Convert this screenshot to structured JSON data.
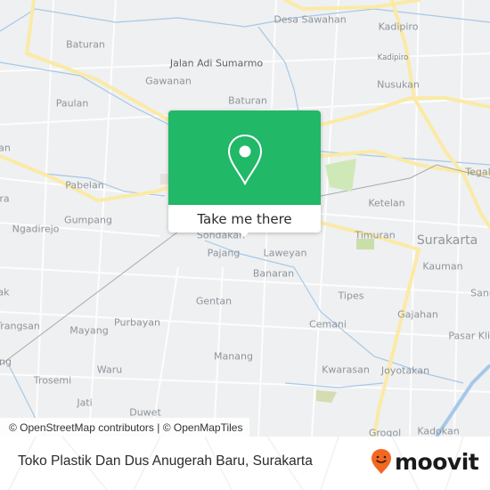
{
  "map": {
    "labels": [
      {
        "text": "Desa Sawahan",
        "kind": "normal"
      },
      {
        "text": "Kadipiro",
        "kind": "normal"
      },
      {
        "text": "Kadipiro",
        "kind": "small"
      },
      {
        "text": "Baturan",
        "kind": "normal"
      },
      {
        "text": "Jalan Adi Sumarmo",
        "kind": "road"
      },
      {
        "text": "Gawanan",
        "kind": "normal"
      },
      {
        "text": "Nusukan",
        "kind": "normal"
      },
      {
        "text": "Baturan",
        "kind": "normal"
      },
      {
        "text": "Paulan",
        "kind": "normal"
      },
      {
        "text": "Pabelan",
        "kind": "normal"
      },
      {
        "text": "Tegalh",
        "kind": "normal"
      },
      {
        "text": "Ketelan",
        "kind": "normal"
      },
      {
        "text": "Gumpang",
        "kind": "normal"
      },
      {
        "text": "Ngadirejo",
        "kind": "normal"
      },
      {
        "text": "Sondakan",
        "kind": "normal"
      },
      {
        "text": "Pajang",
        "kind": "normal"
      },
      {
        "text": "Laweyan",
        "kind": "normal"
      },
      {
        "text": "Timuran",
        "kind": "normal"
      },
      {
        "text": "Surakarta",
        "kind": "city"
      },
      {
        "text": "Kauman",
        "kind": "normal"
      },
      {
        "text": "Banaran",
        "kind": "normal"
      },
      {
        "text": "Tipes",
        "kind": "normal"
      },
      {
        "text": "Sang",
        "kind": "normal"
      },
      {
        "text": "Gentan",
        "kind": "normal"
      },
      {
        "text": "Trangsan",
        "kind": "normal"
      },
      {
        "text": "Purbayan",
        "kind": "normal"
      },
      {
        "text": "Mayang",
        "kind": "normal"
      },
      {
        "text": "Gajahan",
        "kind": "normal"
      },
      {
        "text": "Cemani",
        "kind": "normal"
      },
      {
        "text": "Pasar Kliv",
        "kind": "normal"
      },
      {
        "text": "Waru",
        "kind": "normal"
      },
      {
        "text": "Manang",
        "kind": "normal"
      },
      {
        "text": "Kwarasan",
        "kind": "normal"
      },
      {
        "text": "Joyotakan",
        "kind": "normal"
      },
      {
        "text": "Trosemi",
        "kind": "normal"
      },
      {
        "text": "Jati",
        "kind": "normal"
      },
      {
        "text": "Duwet",
        "kind": "normal"
      },
      {
        "text": "Grogol",
        "kind": "normal"
      },
      {
        "text": "Kadokan",
        "kind": "normal"
      },
      {
        "text": "ak",
        "kind": "normal"
      },
      {
        "text": "an",
        "kind": "normal"
      },
      {
        "text": "ra",
        "kind": "normal"
      },
      {
        "text": "ng",
        "kind": "normal"
      }
    ],
    "attribution": "© OpenStreetMap contributors | © OpenMapTiles"
  },
  "popup": {
    "icon": "map-pin-icon",
    "button_label": "Take me there",
    "color": "#21b868"
  },
  "footer": {
    "title": "Toko Plastik Dan Dus Anugerah Baru, Surakarta",
    "logo_text": "moovit",
    "logo_color": "#f26722"
  }
}
